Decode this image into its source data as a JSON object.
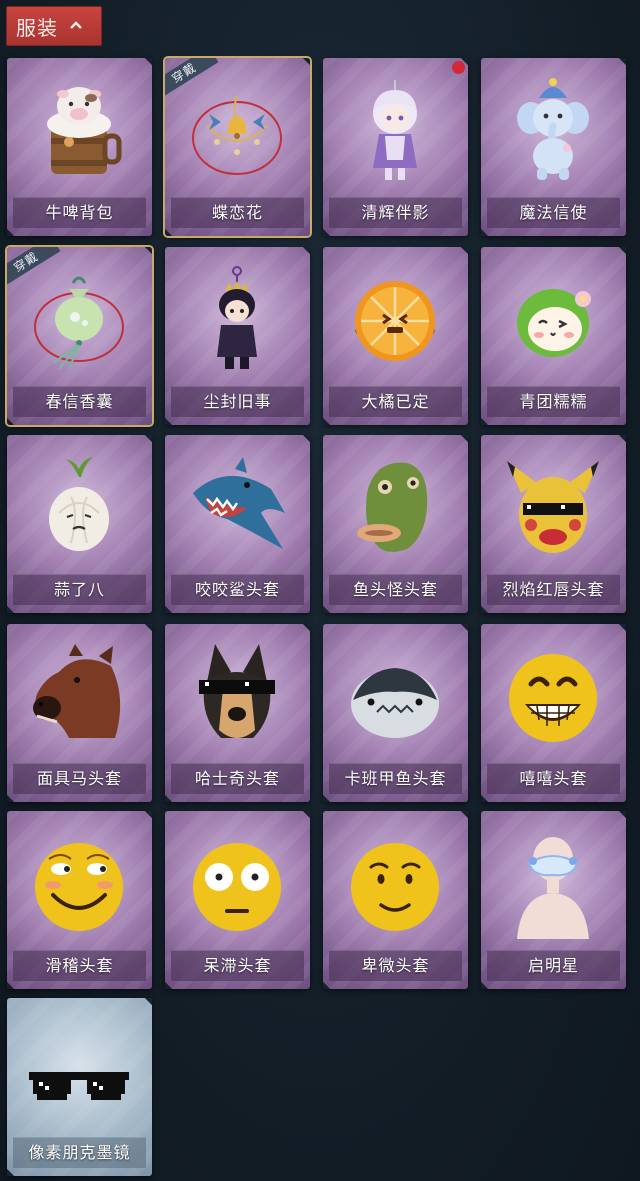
{
  "header": {
    "title": "服装",
    "toggle_icon": "chevron-up-icon"
  },
  "badges": {
    "worn_label": "穿戴"
  },
  "colors": {
    "header_bg": "#b63a35",
    "card_purple": "#a685b5",
    "card_blue": "#b0c2d0",
    "notification": "#d3283a"
  },
  "items": [
    {
      "name": "牛啤背包",
      "icon": "cow-beer-backpack-icon"
    },
    {
      "name": "蝶恋花",
      "icon": "butterfly-bell-ornament-icon",
      "worn": true
    },
    {
      "name": "清辉伴影",
      "icon": "silver-companion-doll-icon",
      "new": true
    },
    {
      "name": "魔法信使",
      "icon": "magic-elephant-messenger-icon"
    },
    {
      "name": "春信香囊",
      "icon": "spring-sachet-icon",
      "worn": true
    },
    {
      "name": "尘封旧事",
      "icon": "crowned-character-charm-icon"
    },
    {
      "name": "大橘已定",
      "icon": "orange-slice-icon"
    },
    {
      "name": "青团糯糯",
      "icon": "green-rice-ball-icon"
    },
    {
      "name": "蒜了八",
      "icon": "garlic-icon"
    },
    {
      "name": "咬咬鲨头套",
      "icon": "shark-head-mask-icon"
    },
    {
      "name": "鱼头怪头套",
      "icon": "fish-head-mask-icon"
    },
    {
      "name": "烈焰红唇头套",
      "icon": "yellow-mouse-mask-icon"
    },
    {
      "name": "面具马头套",
      "icon": "horse-head-mask-icon"
    },
    {
      "name": "哈士奇头套",
      "icon": "husky-head-mask-icon"
    },
    {
      "name": "卡班甲鱼头套",
      "icon": "armored-fish-mask-icon"
    },
    {
      "name": "嘻嘻头套",
      "icon": "grin-face-mask-icon"
    },
    {
      "name": "滑稽头套",
      "icon": "funny-face-mask-icon"
    },
    {
      "name": "呆滞头套",
      "icon": "dazed-face-mask-icon"
    },
    {
      "name": "卑微头套",
      "icon": "humble-face-mask-icon"
    },
    {
      "name": "启明星",
      "icon": "morning-star-headpiece-icon"
    },
    {
      "name": "像素朋克墨镜",
      "icon": "pixel-sunglasses-icon",
      "blue": true
    }
  ]
}
